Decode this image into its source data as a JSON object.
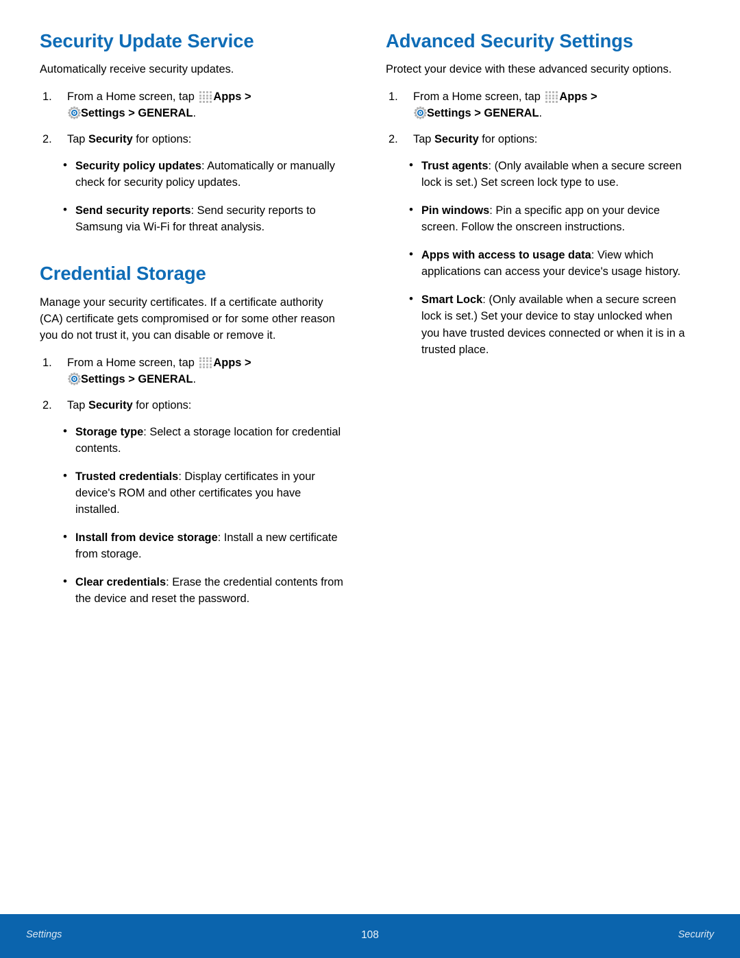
{
  "footer": {
    "left_label": "Settings",
    "page_number": "108",
    "right_label": "Security",
    "bar_color": "#0b64ad"
  },
  "theme": {
    "heading_color": "#0f6cb6",
    "body_color": "#000000",
    "apps_icon_dot_color": "#b8b8b8",
    "gear_icon_color": "#b0b0b0",
    "gear_center_color": "#1273c0"
  },
  "icons": {
    "apps": "apps-grid-icon",
    "settings": "settings-gear-icon"
  },
  "common": {
    "step1_prefix": "From a Home screen, tap",
    "apps_label": "Apps",
    "chevron": ">",
    "settings_label": "Settings",
    "general_label": "GENERAL",
    "period": ".",
    "step2_tap": "Tap",
    "step2_security": "Security",
    "step2_suffix": "for options:"
  },
  "left_column": {
    "sections": [
      {
        "title": "Security Update Service",
        "intro": "Automatically receive security updates.",
        "bullets": [
          {
            "term": "Security policy updates",
            "desc": ": Automatically or manually check for security policy updates."
          },
          {
            "term": "Send security reports",
            "desc": ": Send security reports to Samsung via Wi-Fi for threat analysis."
          }
        ]
      },
      {
        "title": "Credential Storage",
        "intro": "Manage your security certificates. If a certificate authority (CA) certificate gets compromised or for some other reason you do not trust it, you can disable or remove it.",
        "bullets": [
          {
            "term": "Storage type",
            "desc": ": Select a storage location for credential contents."
          },
          {
            "term": "Trusted credentials",
            "desc": ": Display certificates in your device's ROM and other certificates you have installed."
          },
          {
            "term": "Install from device storage",
            "desc": ": Install a new certificate from storage."
          },
          {
            "term": "Clear credentials",
            "desc": ": Erase the credential contents from the device and reset the password."
          }
        ]
      }
    ]
  },
  "right_column": {
    "sections": [
      {
        "title": "Advanced Security Settings",
        "intro": "Protect your device with these advanced security options.",
        "bullets": [
          {
            "term": "Trust agents",
            "desc": ": (Only available when a secure screen lock is set.) Set screen lock type to use."
          },
          {
            "term": "Pin windows",
            "desc": ": Pin a specific app on your device screen. Follow the onscreen instructions."
          },
          {
            "term": "Apps with access to usage data",
            "desc": ": View which applications can access your device's usage history."
          },
          {
            "term": "Smart Lock",
            "desc": ": (Only available when a secure screen lock is set.) Set your device to stay unlocked when you have trusted devices connected or when it is in a trusted place."
          }
        ]
      }
    ]
  }
}
